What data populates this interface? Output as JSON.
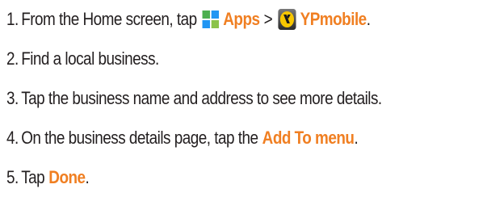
{
  "steps": [
    {
      "num": "1.",
      "text_before": "From the Home screen, tap",
      "icon1": "apps-grid-icon",
      "link1": "Apps",
      "separator": ">",
      "icon2": "ypmobile-logo-icon",
      "link2": "YPmobile",
      "text_after": "."
    },
    {
      "num": "2.",
      "text": "Find a local business."
    },
    {
      "num": "3.",
      "text": "Tap the business name and address to see more details."
    },
    {
      "num": "4.",
      "text_before": "On the business details page, tap the",
      "link": "Add To menu",
      "text_after": "."
    },
    {
      "num": "5.",
      "text_before": "Tap",
      "link": "Done",
      "text_after": "."
    }
  ],
  "colors": {
    "text": "#231f20",
    "highlight": "#f07f22",
    "apps_icon": [
      "#4caf50",
      "#2196f3",
      "#2196f3",
      "#8bc34a"
    ],
    "yp_icon_bg": "#f7c600"
  }
}
